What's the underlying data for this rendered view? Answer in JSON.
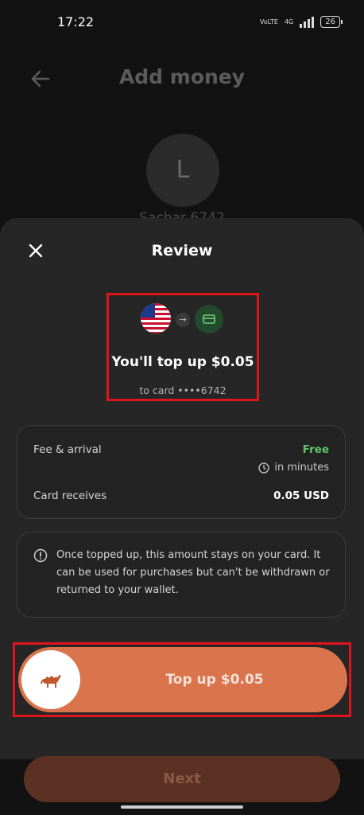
{
  "status_bar": {
    "time": "17:22",
    "network": "4G",
    "battery": "26"
  },
  "background": {
    "title": "Add money",
    "avatar_letter": "L",
    "name_partial": "Sachar 6742",
    "next_label": "Next"
  },
  "sheet": {
    "title": "Review",
    "summary": {
      "headline": "You'll top up $0.05",
      "destination": "to card ••••6742"
    },
    "fee": {
      "fee_label": "Fee & arrival",
      "fee_value": "Free",
      "arrival": "in minutes",
      "receives_label": "Card receives",
      "receives_value": "0.05 USD"
    },
    "info": "Once topped up, this amount stays on your card. It can be used for purchases but can't be withdrawn or returned to your wallet.",
    "slider_label": "Top up $0.05"
  },
  "colors": {
    "accent": "#d9744c",
    "free": "#5ec46a",
    "highlight": "#e0141b"
  }
}
